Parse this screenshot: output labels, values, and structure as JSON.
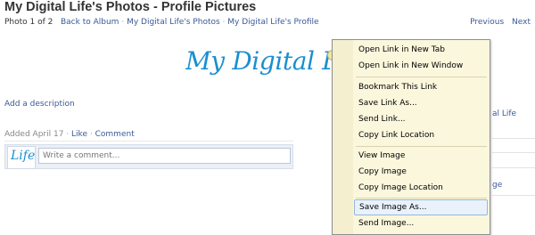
{
  "page": {
    "title": "My Digital Life's Photos - Profile Pictures",
    "photo_count": "Photo 1 of 2",
    "breadcrumbs": [
      "Back to Album",
      "My Digital Life's Photos",
      "My Digital Life's Profile"
    ],
    "pager": {
      "previous": "Previous",
      "next": "Next"
    }
  },
  "photo": {
    "brand_text": "My Digital Life"
  },
  "details": {
    "add_description": "Add a description",
    "added": "Added April 17",
    "like": "Like",
    "comment": "Comment"
  },
  "comment": {
    "avatar_text": "Life",
    "placeholder": "Write a comment..."
  },
  "right_fragments": {
    "profile_fragment": "al Life",
    "link_fragment": "ge"
  },
  "context_menu": {
    "items": [
      "Open Link in New Tab",
      "Open Link in New Window",
      "Bookmark This Link",
      "Save Link As...",
      "Send Link...",
      "Copy Link Location",
      "View Image",
      "Copy Image",
      "Copy Image Location",
      "Save Image As...",
      "Send Image..."
    ],
    "hovered_item": "Save Image As..."
  },
  "colors": {
    "link": "#3b5998",
    "brand": "#1a8fd0",
    "menu_bg": "#fbf7dd",
    "menu_hover": "#e9f2fb"
  }
}
